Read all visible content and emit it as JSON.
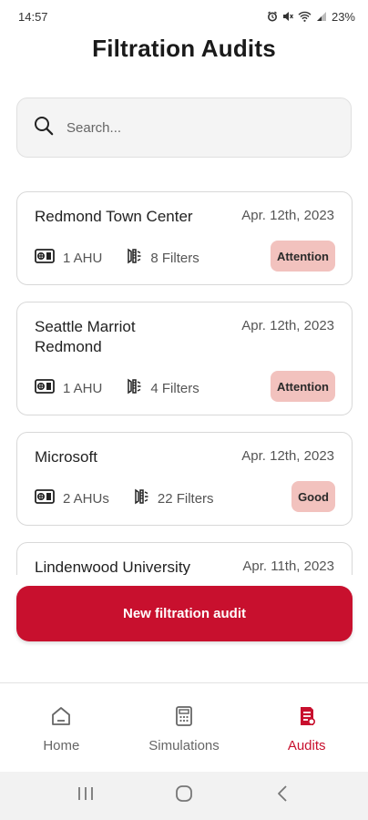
{
  "status_bar": {
    "time": "14:57",
    "battery": "23%",
    "icons": [
      "alarm-icon",
      "mute-icon",
      "wifi-icon",
      "signal-icon"
    ]
  },
  "page": {
    "title": "Filtration Audits"
  },
  "search": {
    "placeholder": "Search...",
    "value": ""
  },
  "audits": [
    {
      "name": "Redmond Town Center",
      "date": "Apr. 12th, 2023",
      "ahu": "1 AHU",
      "filters": "8 Filters",
      "status": "Attention"
    },
    {
      "name": "Seattle Marriot Redmond",
      "date": "Apr. 12th, 2023",
      "ahu": "1 AHU",
      "filters": "4 Filters",
      "status": "Attention"
    },
    {
      "name": "Microsoft",
      "date": "Apr. 12th, 2023",
      "ahu": "2 AHUs",
      "filters": "22 Filters",
      "status": "Good"
    },
    {
      "name": "Lindenwood University",
      "date": "Apr. 11th, 2023",
      "ahu": "",
      "filters": "",
      "status": ""
    }
  ],
  "actions": {
    "new_audit_label": "New filtration audit"
  },
  "bottom_nav": {
    "items": [
      {
        "label": "Home",
        "icon": "home-icon",
        "active": false
      },
      {
        "label": "Simulations",
        "icon": "calculator-icon",
        "active": false
      },
      {
        "label": "Audits",
        "icon": "document-icon",
        "active": true
      }
    ]
  },
  "colors": {
    "accent": "#c8102e",
    "badge_bg": "#f2c2be"
  }
}
